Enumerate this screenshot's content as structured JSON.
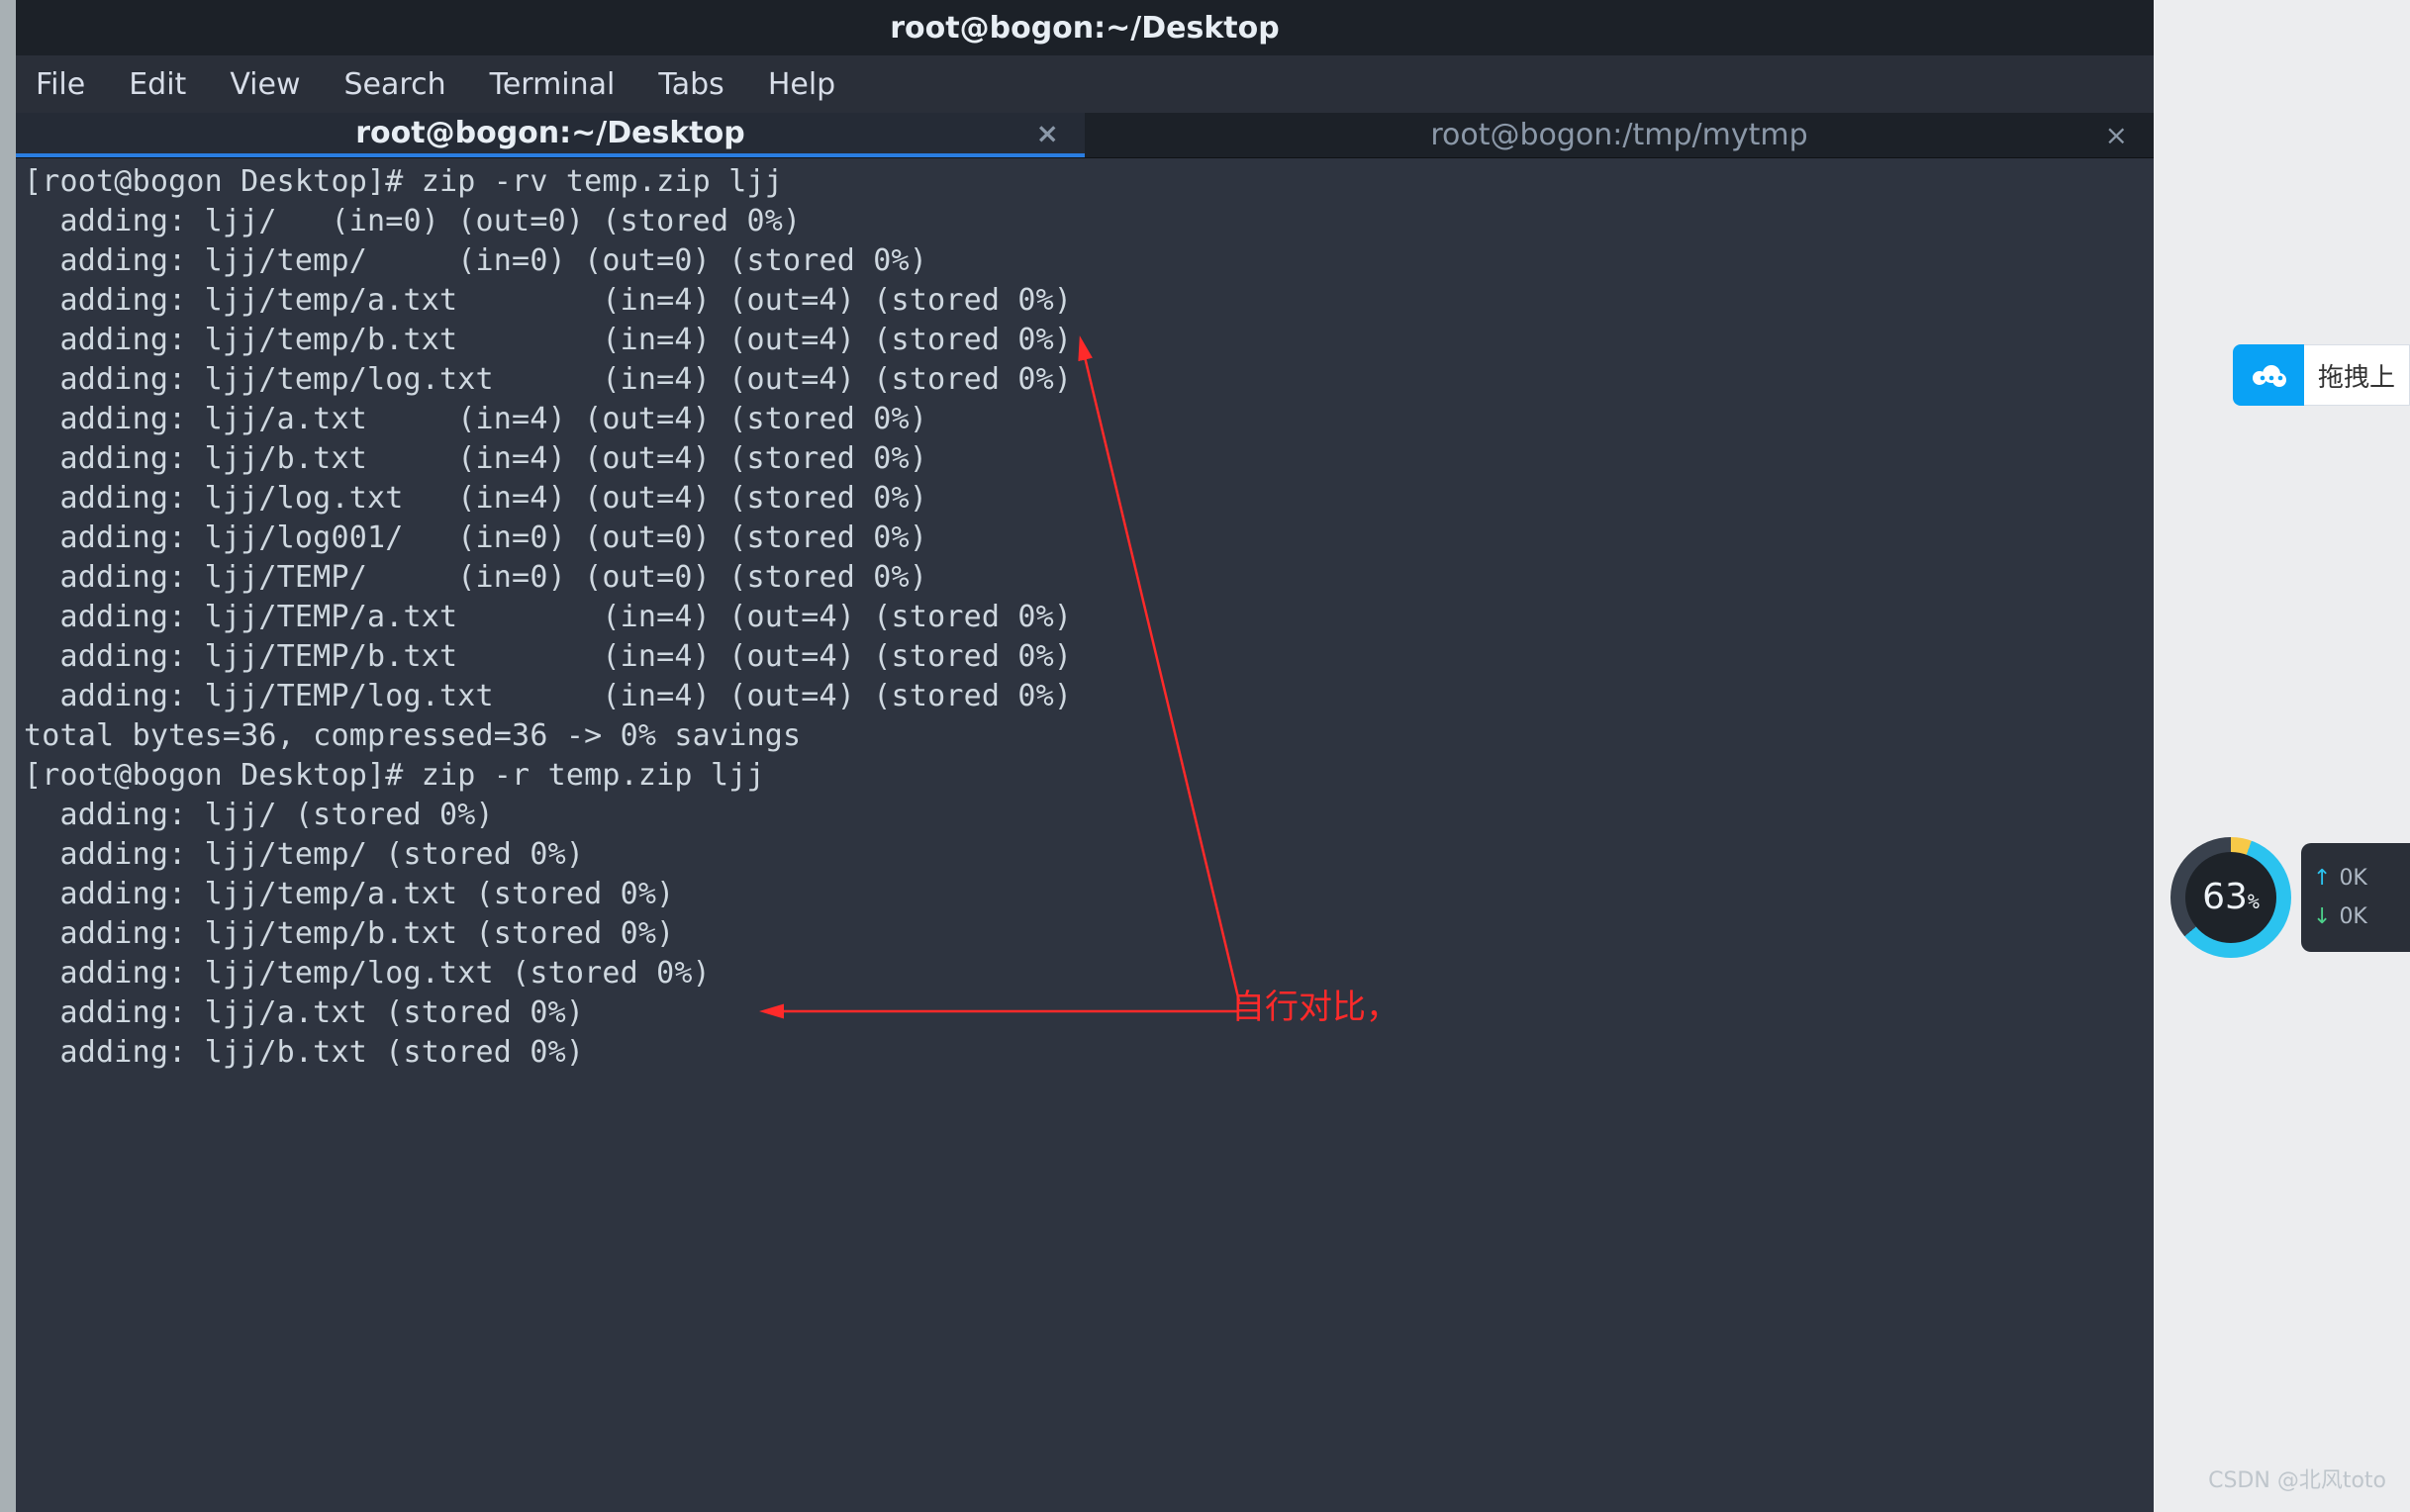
{
  "window": {
    "title": "root@bogon:~/Desktop"
  },
  "menu": {
    "items": [
      "File",
      "Edit",
      "View",
      "Search",
      "Terminal",
      "Tabs",
      "Help"
    ]
  },
  "tabs": [
    {
      "label": "root@bogon:~/Desktop",
      "active": true
    },
    {
      "label": "root@bogon:/tmp/mytmp",
      "active": false
    }
  ],
  "terminal": {
    "lines": [
      "[root@bogon Desktop]# zip -rv temp.zip ljj",
      "  adding: ljj/   (in=0) (out=0) (stored 0%)",
      "  adding: ljj/temp/     (in=0) (out=0) (stored 0%)",
      "  adding: ljj/temp/a.txt        (in=4) (out=4) (stored 0%)",
      "  adding: ljj/temp/b.txt        (in=4) (out=4) (stored 0%)",
      "  adding: ljj/temp/log.txt      (in=4) (out=4) (stored 0%)",
      "  adding: ljj/a.txt     (in=4) (out=4) (stored 0%)",
      "  adding: ljj/b.txt     (in=4) (out=4) (stored 0%)",
      "  adding: ljj/log.txt   (in=4) (out=4) (stored 0%)",
      "  adding: ljj/log001/   (in=0) (out=0) (stored 0%)",
      "  adding: ljj/TEMP/     (in=0) (out=0) (stored 0%)",
      "  adding: ljj/TEMP/a.txt        (in=4) (out=4) (stored 0%)",
      "  adding: ljj/TEMP/b.txt        (in=4) (out=4) (stored 0%)",
      "  adding: ljj/TEMP/log.txt      (in=4) (out=4) (stored 0%)",
      "total bytes=36, compressed=36 -> 0% savings",
      "[root@bogon Desktop]# zip -r temp.zip ljj",
      "  adding: ljj/ (stored 0%)",
      "  adding: ljj/temp/ (stored 0%)",
      "  adding: ljj/temp/a.txt (stored 0%)",
      "  adding: ljj/temp/b.txt (stored 0%)",
      "  adding: ljj/temp/log.txt (stored 0%)",
      "  adding: ljj/a.txt (stored 0%)",
      "  adding: ljj/b.txt (stored 0%)"
    ]
  },
  "annotation": {
    "text": "自行对比，"
  },
  "upload_pill": {
    "text": "拖拽上"
  },
  "dial": {
    "value": "63",
    "suffix": "%"
  },
  "net": {
    "up": "0K",
    "down": "0K"
  },
  "watermark": "CSDN @北风toto"
}
